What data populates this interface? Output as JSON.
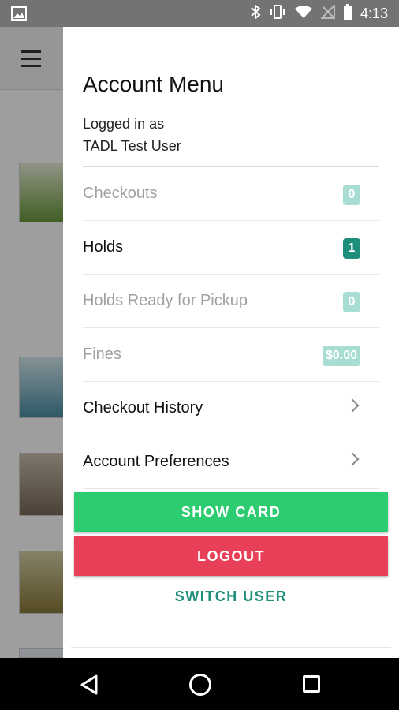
{
  "status_bar": {
    "time": "4:13",
    "icons": [
      "image-icon",
      "bluetooth-icon",
      "vibrate-icon",
      "wifi-icon",
      "no-signal-icon",
      "battery-icon"
    ]
  },
  "drawer": {
    "title": "Account Menu",
    "logged_in_line1": "Logged in as",
    "logged_in_line2": "TADL Test User",
    "items": [
      {
        "label": "Checkouts",
        "badge": "0"
      },
      {
        "label": "Holds",
        "badge": "1"
      },
      {
        "label": "Holds Ready for Pickup",
        "badge": "0"
      },
      {
        "label": "Fines",
        "badge": "$0.00"
      },
      {
        "label": "Checkout History"
      },
      {
        "label": "Account Preferences"
      }
    ],
    "show_card_label": "SHOW CARD",
    "logout_label": "LOGOUT",
    "switch_user_label": "SWITCH USER"
  },
  "colors": {
    "accent": "#1e8f7a",
    "show_card": "#2ecc71",
    "logout": "#e84058",
    "badge_muted": "#a7ddd3"
  }
}
